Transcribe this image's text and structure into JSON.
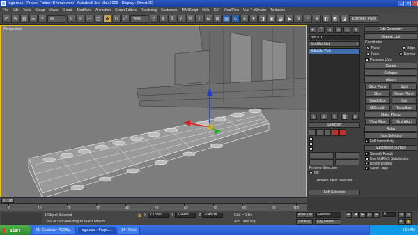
{
  "window": {
    "title": "lego.max    -  Project Folder: D:\\max work     -  Autodesk 3ds Max  2009       -  Display : Direct 3D",
    "minimize": "_",
    "maximize": "□",
    "close": "×"
  },
  "menu": [
    "File",
    "Edit",
    "Tools",
    "Group",
    "Views",
    "Create",
    "Modifiers",
    "Animation",
    "Graph Editors",
    "Rendering",
    "Customize",
    "MAXScript",
    "Help",
    "CAT",
    "RealFlow",
    "Vue 7 xStream",
    "Tentacles"
  ],
  "toolbar": {
    "filter": "All",
    "view": "View",
    "named_selection": "Extended Paint"
  },
  "viewport": {
    "label": "Perspective"
  },
  "command_panel": {
    "object_name": "Box201",
    "modifier_list": "Modifier List",
    "stack_item": "Editable Poly",
    "selection_rollout": "Selection",
    "preview_selection_label": "Preview Selection",
    "preview_off": "Off",
    "whole_object_selected": "Whole Object Selected",
    "soft_selection_rollout": "Soft Selection",
    "edit_geometry_rollout": "Edit Geometry",
    "repeat_last": "Repeat Last",
    "constraints_label": "Constraints",
    "constraints": [
      "None",
      "Edge",
      "Face",
      "Normal"
    ],
    "preserve_uvs": "Preserve UVs",
    "create": "Create",
    "collapse": "Collapse",
    "attach": "Attach",
    "slice_plane": "Slice Plane",
    "split": "Split",
    "slice": "Slice",
    "reset_plane": "Reset Plane",
    "quickslice": "QuickSlice",
    "cut": "Cut",
    "msmooth": "MSmooth",
    "tessellate": "Tessellate",
    "make_planar": "Make Planar",
    "view_align": "View Align",
    "grid_align": "Grid Align",
    "relax": "Relax",
    "hide_selected": "Hide Selected",
    "full_interactivity": "Full Interactivity",
    "subdivision_surface": "Subdivision Surface",
    "smooth_result": "Smooth Result",
    "use_nurms": "Use NURMS Subdivision",
    "isoline_display": "Isoline Display",
    "show_cage": "Show Cage......"
  },
  "timeline": {
    "slider": "0 / 100",
    "ticks": [
      "0",
      "10",
      "20",
      "30",
      "40",
      "50",
      "60",
      "70",
      "80",
      "90",
      "100"
    ]
  },
  "status": {
    "objects_selected": "1 Object Selected",
    "prompt": "Click or click-and-drag to select objects",
    "x": "2.185m",
    "y": "3.666m",
    "z": "-0.457m",
    "grid": "Grid = 0.1m",
    "auto_key": "Auto Key",
    "selected": "Selected",
    "set_key": "Set Key",
    "key_filters": "Key Filters...",
    "add_time_tag": "Add Time Tag",
    "frame": "0"
  },
  "taskbar": {
    "start": "start",
    "items": [
      "My Contests - PSSEy...",
      "lego.max - Project...",
      "24 - Paint"
    ],
    "clock": "6:21 AM"
  }
}
